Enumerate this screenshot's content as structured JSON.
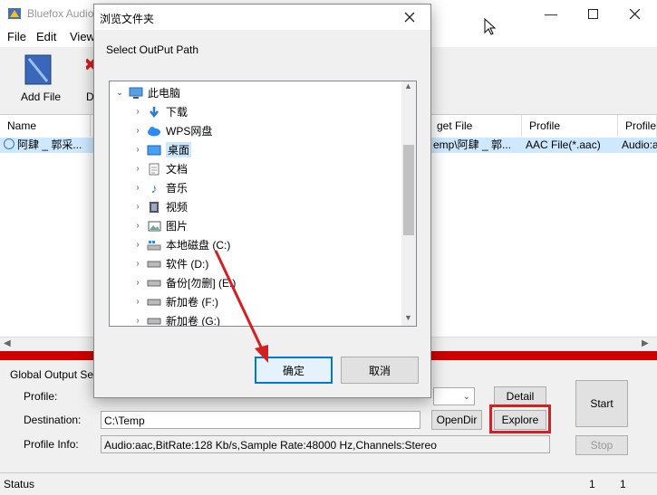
{
  "app": {
    "title": "Bluefox Audio"
  },
  "menu": {
    "items": [
      "File",
      "Edit",
      "View"
    ]
  },
  "toolbar": {
    "add_file": "Add File",
    "d_label": "D"
  },
  "columns": [
    "Name",
    "get File",
    "Profile",
    "Profile I"
  ],
  "row": {
    "name": "阿肆 _ 郭采...",
    "target": "emp\\阿肆 _ 郭...",
    "profile": "AAC File(*.aac)",
    "profile_info": "Audio:a"
  },
  "settings": {
    "heading": "Global Output Setti",
    "profile_label": "Profile:",
    "destination_label": "Destination:",
    "destination_value": "C:\\Temp",
    "profile_info_label": "Profile Info:",
    "profile_info_value": "Audio:aac,BitRate:128 Kb/s,Sample Rate:48000 Hz,Channels:Stereo",
    "detail_btn": "Detail",
    "opendir_btn": "OpenDir",
    "explore_btn": "Explore",
    "start_btn": "Start",
    "stop_btn": "Stop"
  },
  "status": {
    "label": "Status",
    "count1": "1",
    "count2": "1"
  },
  "dialog": {
    "title": "浏览文件夹",
    "prompt": "Select OutPut Path",
    "ok": "确定",
    "cancel": "取消",
    "tree": [
      {
        "label": "此电脑",
        "icon": "computer-icon"
      },
      {
        "label": "下载",
        "icon": "download-icon"
      },
      {
        "label": "WPS网盘",
        "icon": "cloud-icon"
      },
      {
        "label": "桌面",
        "icon": "desktop-icon"
      },
      {
        "label": "文档",
        "icon": "document-icon"
      },
      {
        "label": "音乐",
        "icon": "music-icon"
      },
      {
        "label": "视频",
        "icon": "video-icon"
      },
      {
        "label": "图片",
        "icon": "picture-icon"
      },
      {
        "label": "本地磁盘 (C:)",
        "icon": "system-drive-icon"
      },
      {
        "label": "软件 (D:)",
        "icon": "drive-icon"
      },
      {
        "label": "备份[勿删] (E:)",
        "icon": "drive-icon"
      },
      {
        "label": "新加卷 (F:)",
        "icon": "drive-icon"
      },
      {
        "label": "新加卷 (G:)",
        "icon": "drive-icon"
      }
    ]
  },
  "colors": {
    "accent_red": "#cc0000",
    "selection": "#cde8ff",
    "arrow": "#d42020"
  }
}
